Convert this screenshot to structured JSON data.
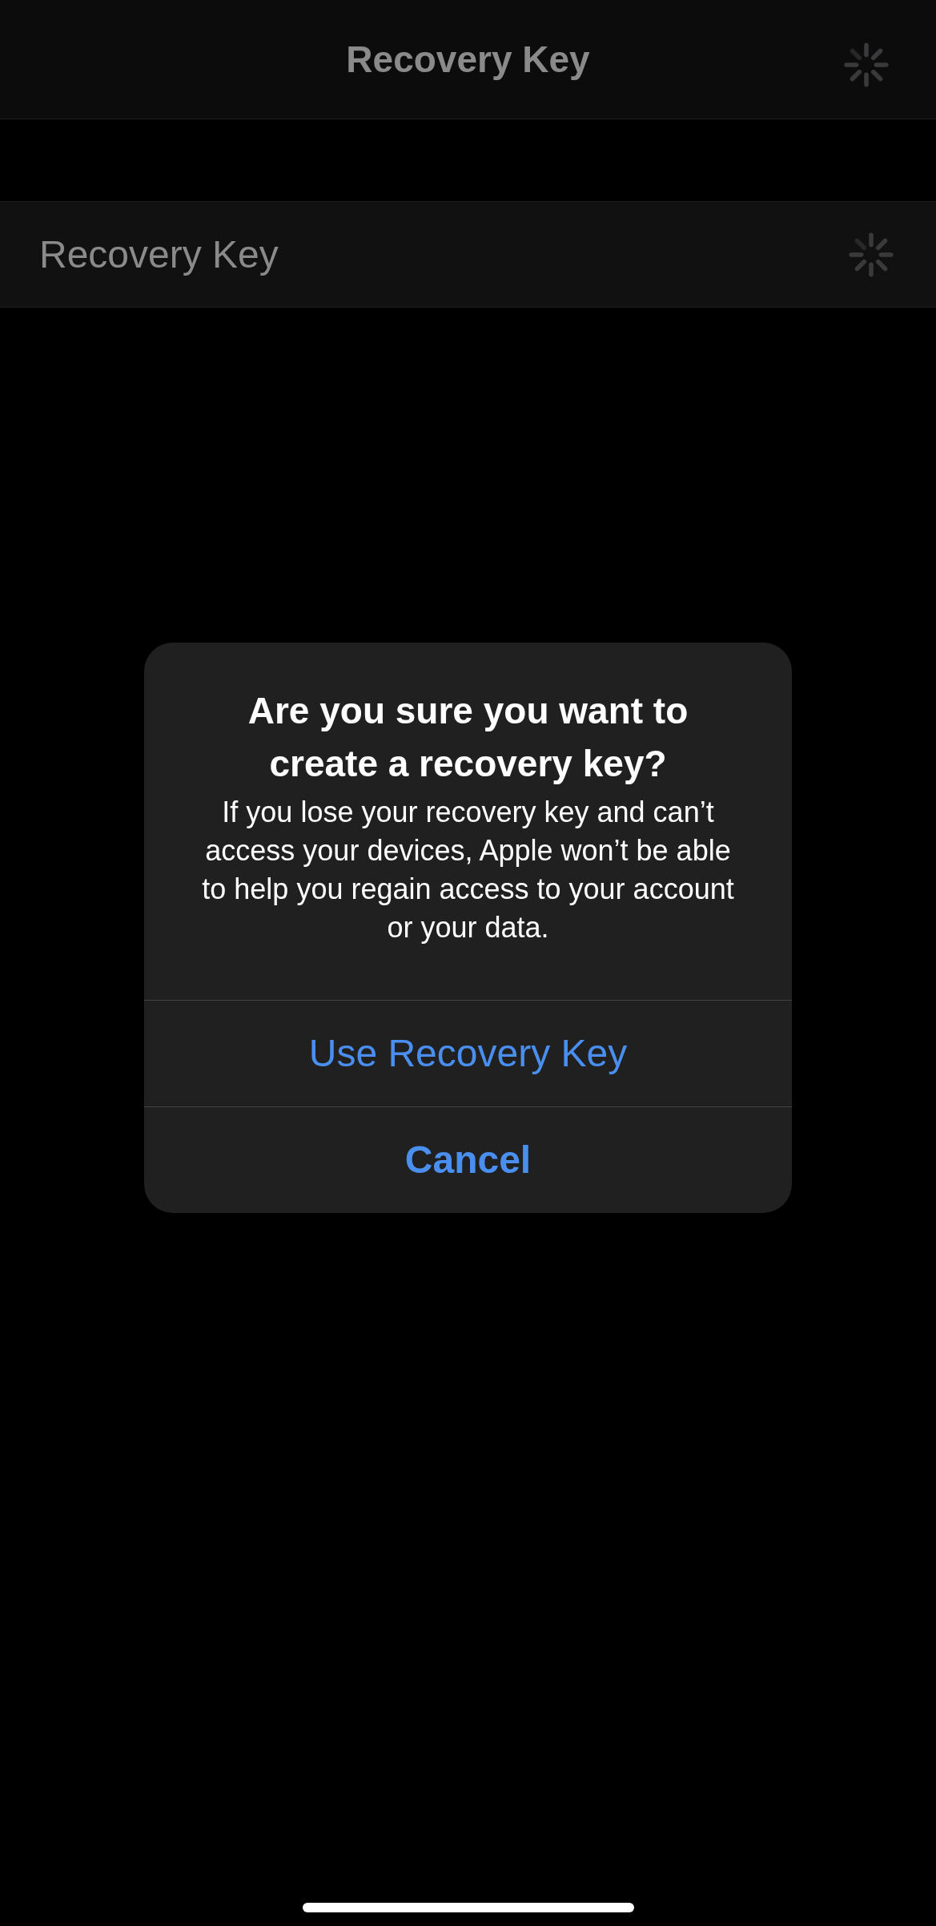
{
  "nav_bar": {
    "title": "Recovery Key",
    "loading": true
  },
  "list_row": {
    "label": "Recovery Key",
    "loading": true
  },
  "alert": {
    "title": "Are you sure you want to create a recovery key?",
    "message": "If you lose your recovery key and can’t access your devices, Apple won’t be able to help you regain access to your account or your data.",
    "buttons": [
      {
        "label": "Use Recovery Key",
        "kind": "default"
      },
      {
        "label": "Cancel",
        "kind": "cancel"
      }
    ]
  }
}
